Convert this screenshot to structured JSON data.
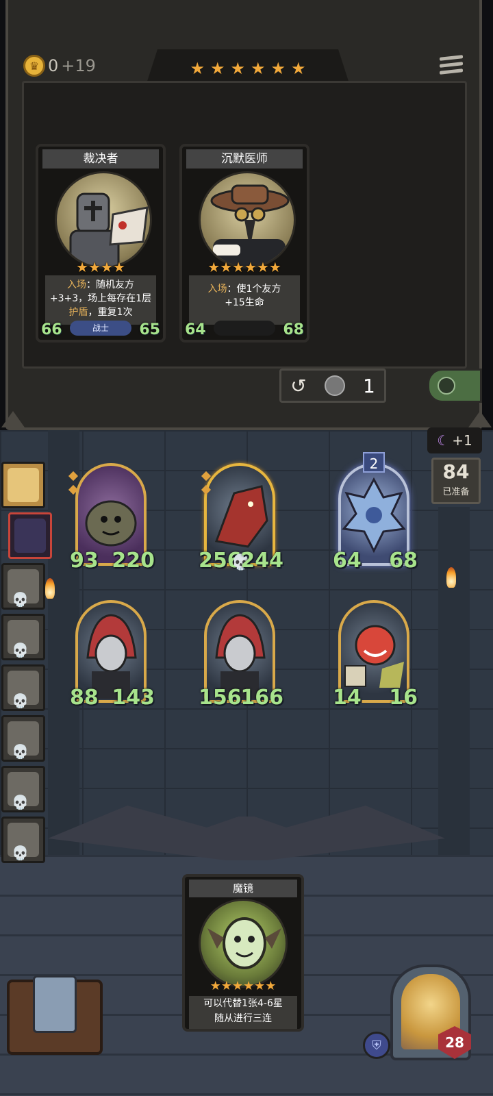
{
  "shop": {
    "gold_current": "0",
    "gold_income": "+19",
    "tavern_stars": 6,
    "refresh_cost": "1",
    "cards": [
      {
        "name": "裁决者",
        "stars": 4,
        "desc_kw1": "入场",
        "desc_line1": "：随机友方",
        "desc_line2": "+3+3，场上每存在1层",
        "desc_kw2": "护盾",
        "desc_line3": "，重复1次",
        "attack": "66",
        "health": "65",
        "tag": "战士"
      },
      {
        "name": "沉默医师",
        "stars": 6,
        "desc_kw1": "入场",
        "desc_line1": "：使1个友方",
        "desc_line2": "+15生命",
        "attack": "64",
        "health": "68",
        "tag": ""
      }
    ]
  },
  "roster_ready": {
    "moon_bonus": "+1",
    "count": "84",
    "label": "已准备"
  },
  "board": {
    "row1": [
      {
        "attack": "93",
        "health": "220",
        "style": "purple"
      },
      {
        "attack": "256",
        "health": "244",
        "style": "gold-glow",
        "deathrattle": true
      },
      {
        "attack": "64",
        "health": "68",
        "style": "blue",
        "tier": "2"
      }
    ],
    "row2": [
      {
        "attack": "88",
        "health": "143"
      },
      {
        "attack": "156",
        "health": "166"
      },
      {
        "attack": "14",
        "health": "16"
      }
    ]
  },
  "hand": {
    "card": {
      "name": "魔镜",
      "stars": 6,
      "desc_line1": "可以代替1张4-6星",
      "desc_line2": "随从进行三连"
    }
  },
  "hero": {
    "health": "28"
  },
  "icons": {
    "star": "★",
    "skull": "💀",
    "moon": "☾",
    "refresh": "↺"
  }
}
